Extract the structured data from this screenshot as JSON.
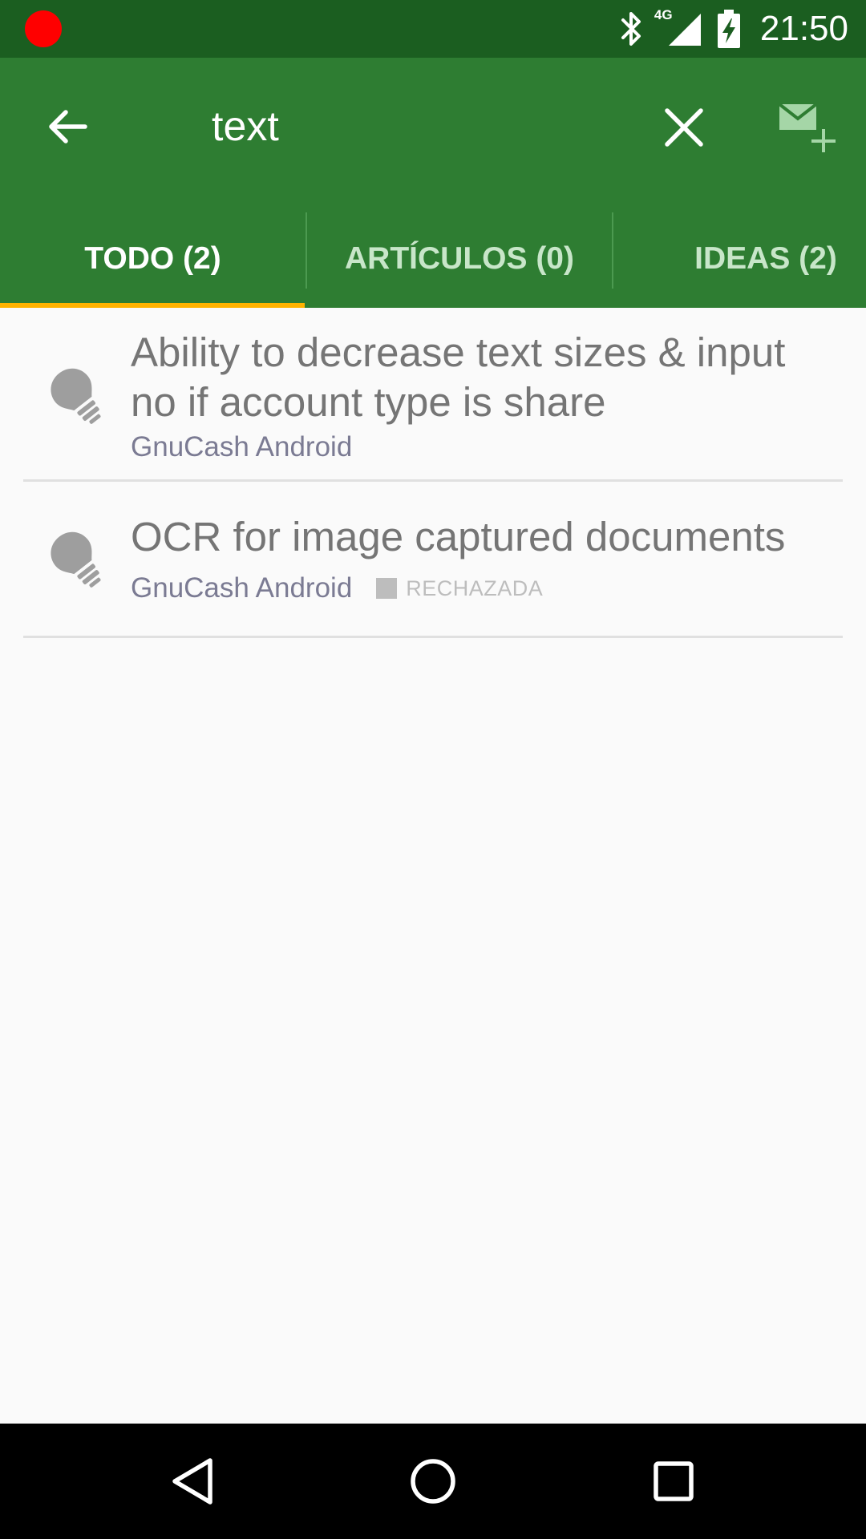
{
  "status_bar": {
    "time": "21:50",
    "network": "4G",
    "icons": [
      "recording-icon",
      "bluetooth-icon",
      "cell-signal-icon",
      "battery-charging-icon"
    ],
    "colors": {
      "background": "#1b5e20",
      "recording": "#ff0000"
    }
  },
  "toolbar": {
    "search_query": "text",
    "icons": [
      "back-arrow-icon",
      "close-icon",
      "compose-mail-icon"
    ],
    "colors": {
      "background": "#2e7d32"
    }
  },
  "tabs": [
    {
      "label": "TODO (2)",
      "selected": true
    },
    {
      "label": "ARTÍCULOS (0)",
      "selected": false
    },
    {
      "label": "IDEAS (2)",
      "selected": false
    }
  ],
  "tab_indicator_color": "#ffb300",
  "results": [
    {
      "icon": "lightbulb-icon",
      "title": "Ability to decrease text sizes & input no if account type is share",
      "source": "GnuCash Android"
    },
    {
      "icon": "lightbulb-icon",
      "title": "OCR for image captured documents",
      "source": "GnuCash Android",
      "status": "RECHAZADA"
    }
  ],
  "nav_bar": {
    "icons": [
      "nav-back-icon",
      "nav-home-icon",
      "nav-recents-icon"
    ]
  }
}
